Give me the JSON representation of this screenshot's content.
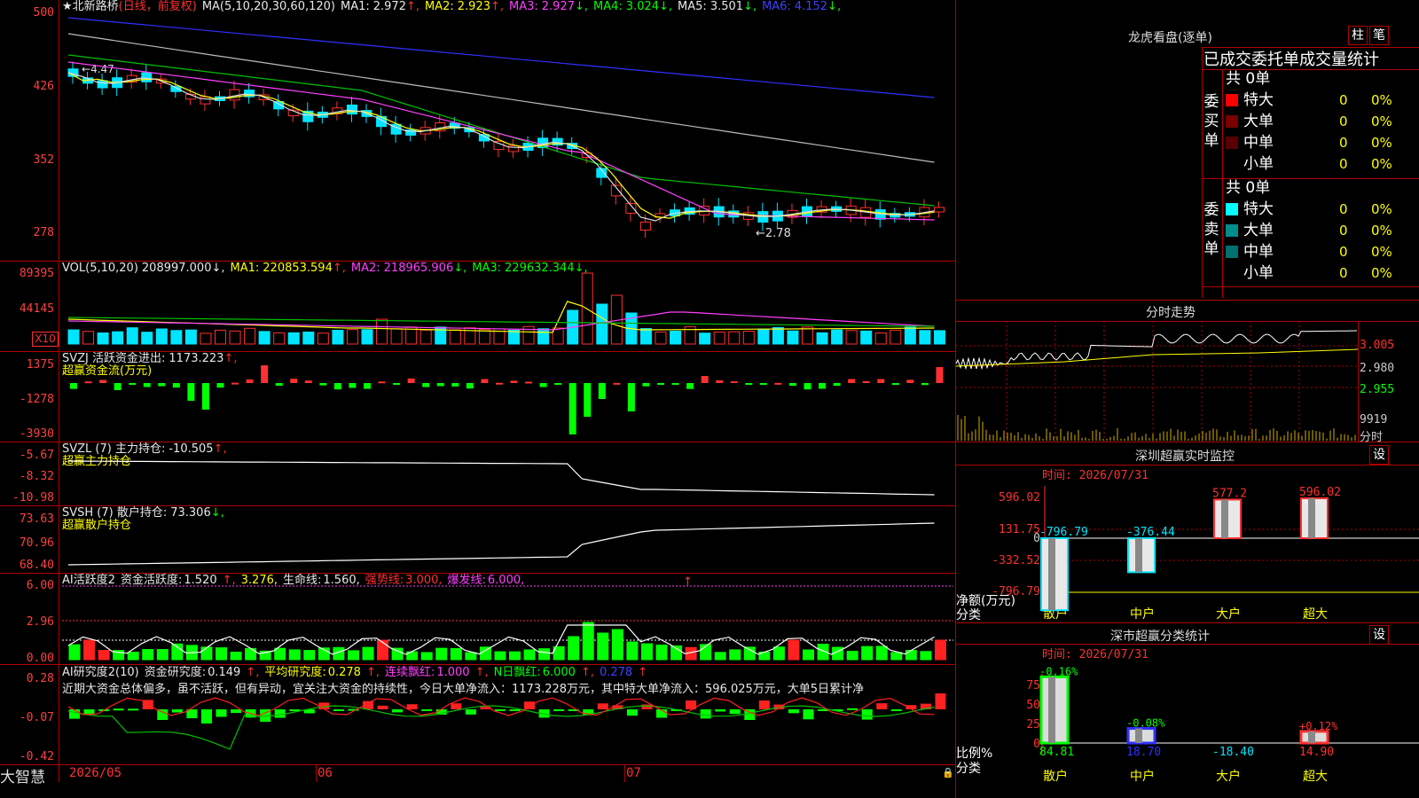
{
  "stock": {
    "name": "★北新路桥",
    "mode": "(日线，前复权)"
  },
  "panels": {
    "price": {
      "ma_label": "MA(5,10,20,30,60,120)",
      "ma": [
        {
          "k": "MA1:",
          "v": "2.972",
          "a": "↑",
          "c": "#e8e8e8"
        },
        {
          "k": "MA2:",
          "v": "2.923",
          "a": "↑",
          "c": "#ffff00"
        },
        {
          "k": "MA3:",
          "v": "2.927",
          "a": "↓",
          "c": "#ff40ff"
        },
        {
          "k": "MA4:",
          "v": "3.024",
          "a": "↓",
          "c": "#00ff00"
        },
        {
          "k": "MA5:",
          "v": "3.501",
          "a": "↓",
          "c": "#e8e8e8"
        },
        {
          "k": "MA6:",
          "v": "4.152",
          "a": "↓",
          "c": "#4040ff"
        }
      ],
      "axis": [
        "500",
        "426",
        "352",
        "278"
      ],
      "high_note": "4.47",
      "low_note": "←2.78"
    },
    "vol": {
      "label": "VOL(5,10,20)",
      "value": "208997.000↓,",
      "ma": [
        {
          "k": "MA1:",
          "v": "220853.594",
          "a": "↑",
          "c": "#ffff00"
        },
        {
          "k": "MA2:",
          "v": "218965.906",
          "a": "↓",
          "c": "#ff40ff"
        },
        {
          "k": "MA3:",
          "v": "229632.344",
          "a": "↓",
          "c": "#00ff00"
        }
      ],
      "axis": [
        "89395",
        "44145"
      ],
      "unit": "X10"
    },
    "svzj": {
      "label": "SVZJ  活跃资金进出:",
      "value": "1173.223",
      "arrow": "↑,",
      "sub": "超赢资金流(万元)",
      "axis": [
        "1375",
        "-1278",
        "-3930"
      ]
    },
    "svzl": {
      "label": "SVZL (7) 主力持仓:",
      "value": "-10.505",
      "arrow": "↑,",
      "sub": "超赢主力持仓",
      "axis": [
        "-5.67",
        "-8.32",
        "-10.98"
      ]
    },
    "svsh": {
      "label": "SVSH (7) 散户持仓:",
      "value": "73.306",
      "arrow": "↓,",
      "sub": "超赢散户持仓",
      "axis": [
        "73.63",
        "70.96",
        "68.40"
      ]
    },
    "ai1": {
      "label": "AI活跃度2",
      "items": [
        {
          "t": "资金活跃度:",
          "c": "#e8e8e8"
        },
        {
          "t": "1.520",
          "c": "#e8e8e8"
        },
        {
          "t": "↑,",
          "c": "#ff3030"
        },
        {
          "t": "3.276,",
          "c": "#ffff00"
        },
        {
          "t": "生命线:",
          "c": "#e8e8e8"
        },
        {
          "t": "1.560,",
          "c": "#e8e8e8"
        },
        {
          "t": "强势线:",
          "c": "#ff3030"
        },
        {
          "t": "3.000,",
          "c": "#ff3030"
        },
        {
          "t": "爆发线:",
          "c": "#ff40ff"
        },
        {
          "t": "6.000,",
          "c": "#ff40ff"
        }
      ],
      "axis": [
        "6.00",
        "2.96",
        "0.00"
      ]
    },
    "ai2": {
      "label": "AI研究度2(10)",
      "items": [
        {
          "t": "资金研究度:",
          "c": "#e8e8e8"
        },
        {
          "t": "0.149",
          "c": "#e8e8e8"
        },
        {
          "t": "↑,",
          "c": "#ff3030"
        },
        {
          "t": "平均研究度:",
          "c": "#ffff00"
        },
        {
          "t": "0.278",
          "c": "#ffff00"
        },
        {
          "t": "↑,",
          "c": "#ff3030"
        },
        {
          "t": "连续飘红:",
          "c": "#ff40ff"
        },
        {
          "t": "1.000",
          "c": "#ff40ff"
        },
        {
          "t": "↑,",
          "c": "#ff3030"
        },
        {
          "t": "N日飘红:",
          "c": "#00ff00"
        },
        {
          "t": "6.000",
          "c": "#00ff00"
        },
        {
          "t": "↑,",
          "c": "#ff3030"
        },
        {
          "t": "0.278",
          "c": "#4040ff"
        },
        {
          "t": "↑",
          "c": "#ff3030"
        }
      ],
      "axis": [
        "0.28",
        "-0.07",
        "-0.42"
      ],
      "comment": "近期大资金总体偏多，虽不活跃，但有异动，宜关注大资金的持续性，今日大单净流入：1173.228万元，其中特大单净流入：596.025万元，大单5日累计净"
    }
  },
  "date_axis": [
    "2026/05",
    "06",
    "07"
  ],
  "brand": "大智慧",
  "right": {
    "lhb": {
      "title": "龙虎看盘(逐单)",
      "btn1": "柱",
      "btn2": "笔",
      "table_title": "已成交委托单成交量统计",
      "buy": {
        "total": "共 0单",
        "side": "委买单",
        "rows": [
          {
            "l": "特大",
            "n": "0",
            "p": "0%",
            "c": "#ff0000"
          },
          {
            "l": "大单",
            "n": "0",
            "p": "0%",
            "c": "#7a0000"
          },
          {
            "l": "中单",
            "n": "0",
            "p": "0%",
            "c": "#5a0000"
          },
          {
            "l": "小单",
            "n": "0",
            "p": "0%",
            "c": "none"
          }
        ]
      },
      "sell": {
        "total": "共 0单",
        "side": "委卖单",
        "rows": [
          {
            "l": "特大",
            "n": "0",
            "p": "0%",
            "c": "#00ffff"
          },
          {
            "l": "大单",
            "n": "0",
            "p": "0%",
            "c": "#008c8c"
          },
          {
            "l": "中单",
            "n": "0",
            "p": "0%",
            "c": "#007070"
          },
          {
            "l": "小单",
            "n": "0",
            "p": "0%",
            "c": "none"
          }
        ]
      }
    },
    "intraday": {
      "title": "分时走势",
      "axis": [
        "3.005",
        "2.980",
        "2.955"
      ],
      "vol": "9919",
      "foot": "分时"
    },
    "sz": {
      "title": "深圳超赢实时监控",
      "btn": "设",
      "time": "时间: 2026/07/31",
      "axis": [
        "596.02",
        "131.75",
        "0",
        "-332.52",
        "-796.79"
      ],
      "ylabel": "净额(万元)",
      "xlabel": "分类",
      "cats": [
        "散户",
        "中户",
        "大户",
        "超大"
      ],
      "values": [
        -796.79,
        -376.44,
        577.2,
        596.02
      ],
      "value_labels": [
        "-796.79",
        "-376.44",
        "577.2",
        "596.02"
      ]
    },
    "szstat": {
      "title": "深市超赢分类统计",
      "btn": "设",
      "time": "时间: 2026/07/31",
      "axis": [
        "75",
        "50",
        "25",
        "0"
      ],
      "ylabel": "比例%",
      "xlabel": "分类",
      "cats": [
        "散户",
        "中户",
        "大户",
        "超大"
      ],
      "pct": [
        "-0.16%",
        "-0.08%",
        "",
        "+0.12%"
      ],
      "values": [
        84.81,
        18.7,
        -18.4,
        14.9
      ],
      "value_labels": [
        "84.81",
        "18.70",
        "-18.40",
        "14.90"
      ]
    }
  }
}
